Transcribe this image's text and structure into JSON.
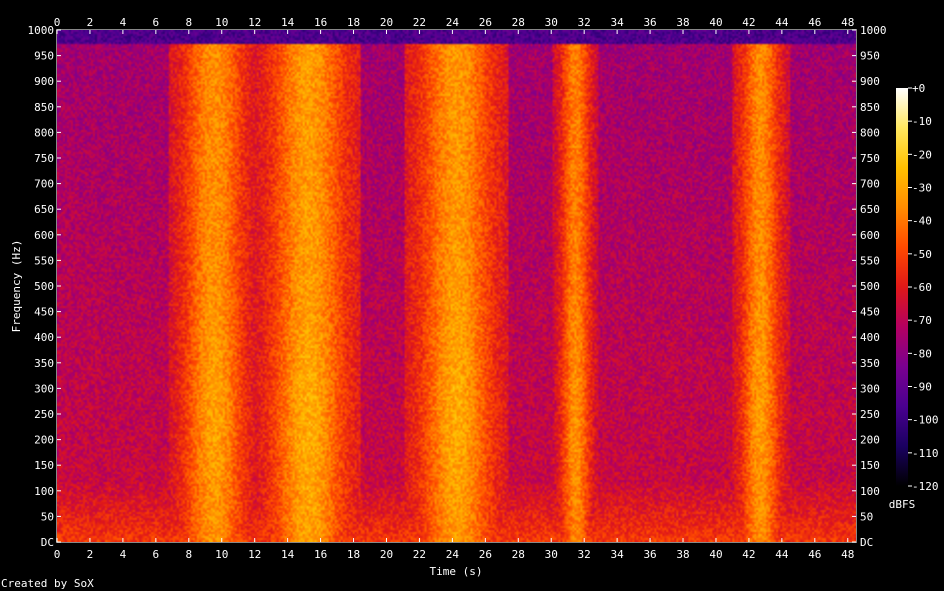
{
  "chart_data": {
    "type": "heatmap",
    "title": "",
    "xlabel": "Time (s)",
    "ylabel": "Frequency (Hz)",
    "xlim": [
      0,
      48.5
    ],
    "ylim": [
      0,
      1000
    ],
    "x_ticks": [
      "0",
      "2",
      "4",
      "6",
      "8",
      "10",
      "12",
      "14",
      "16",
      "18",
      "20",
      "22",
      "24",
      "26",
      "28",
      "30",
      "32",
      "34",
      "36",
      "38",
      "40",
      "42",
      "44",
      "46",
      "48"
    ],
    "y_ticks": [
      "DC",
      "50",
      "100",
      "150",
      "200",
      "250",
      "300",
      "350",
      "400",
      "450",
      "500",
      "550",
      "600",
      "650",
      "700",
      "750",
      "800",
      "850",
      "900",
      "950",
      "1000"
    ],
    "colorbar": {
      "label": "dBFS",
      "ticks": [
        "+0",
        "-10",
        "-20",
        "-30",
        "-40",
        "-50",
        "-60",
        "-70",
        "-80",
        "-90",
        "-100",
        "-110",
        "-120"
      ],
      "range": [
        -120,
        0
      ],
      "colors": [
        "#000000",
        "#1a0060",
        "#4a0090",
        "#7a0090",
        "#b40060",
        "#e01818",
        "#ff4a00",
        "#ff8c00",
        "#ffc000",
        "#ffe860",
        "#ffffff"
      ]
    },
    "energy_regions": [
      {
        "t_start": 7.5,
        "t_end": 11.5,
        "f_peak": 250,
        "level_db": -35
      },
      {
        "t_start": 13.0,
        "t_end": 17.5,
        "f_peak": 240,
        "level_db": -32
      },
      {
        "t_start": 22.0,
        "t_end": 26.5,
        "f_peak": 250,
        "level_db": -33
      },
      {
        "t_start": 30.5,
        "t_end": 32.5,
        "f_peak": 230,
        "level_db": -38
      },
      {
        "t_start": 41.5,
        "t_end": 44.0,
        "f_peak": 250,
        "level_db": -36
      }
    ],
    "quiet_region": {
      "t_start": 34.0,
      "t_end": 40.0,
      "level_db": -80
    },
    "background_level_db": -60
  },
  "footer": {
    "credit": "Created by SoX"
  }
}
